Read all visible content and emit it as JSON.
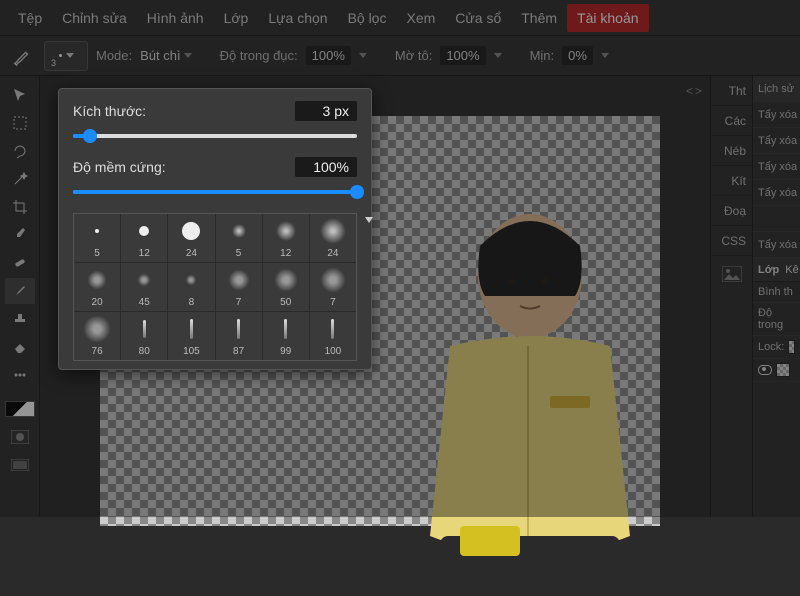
{
  "menubar": [
    "Tệp",
    "Chỉnh sửa",
    "Hình ảnh",
    "Lớp",
    "Lựa chọn",
    "Bộ lọc",
    "Xem",
    "Cửa sổ",
    "Thêm"
  ],
  "menubar_account": "Tài khoản",
  "optbar": {
    "brush_size": "3",
    "mode_label": "Mode:",
    "mode_value": "Bút chì",
    "opacity_label": "Độ trong đục:",
    "opacity_value": "100%",
    "flow_label": "Mờ tô:",
    "flow_value": "100%",
    "smooth_label": "Mịn:",
    "smooth_value": "0%"
  },
  "popup": {
    "size_label": "Kích thước:",
    "size_value": "3 px",
    "size_pct": 6,
    "hard_label": "Độ mềm cứng:",
    "hard_value": "100%",
    "hard_pct": 100,
    "presets": [
      {
        "n": "5",
        "t": "hard",
        "s": 4
      },
      {
        "n": "12",
        "t": "hard",
        "s": 10
      },
      {
        "n": "24",
        "t": "hard",
        "s": 18
      },
      {
        "n": "5",
        "t": "soft",
        "s": 8
      },
      {
        "n": "12",
        "t": "soft",
        "s": 14
      },
      {
        "n": "24",
        "t": "soft",
        "s": 20
      },
      {
        "n": "20",
        "t": "tex",
        "s": 14
      },
      {
        "n": "45",
        "t": "tex",
        "s": 8
      },
      {
        "n": "8",
        "t": "tex",
        "s": 6
      },
      {
        "n": "7",
        "t": "tex",
        "s": 16
      },
      {
        "n": "50",
        "t": "tex",
        "s": 18
      },
      {
        "n": "7",
        "t": "tex",
        "s": 20
      },
      {
        "n": "76",
        "t": "tex",
        "s": 22
      },
      {
        "n": "80",
        "t": "stroke",
        "s": 18
      },
      {
        "n": "105",
        "t": "stroke",
        "s": 20
      },
      {
        "n": "87",
        "t": "stroke",
        "s": 20
      },
      {
        "n": "99",
        "t": "stroke",
        "s": 20
      },
      {
        "n": "100",
        "t": "stroke",
        "s": 20
      }
    ]
  },
  "rpanel": {
    "items": [
      "Tht",
      "Các",
      "Néb",
      "Kít",
      "Đoạ",
      "CSS"
    ],
    "nav": "<>"
  },
  "history": {
    "tab": "Lịch sử",
    "entries": [
      "Tẩy xóa",
      "Tẩy xóa",
      "Tẩy xóa",
      "Tẩy xóa",
      "",
      "Tẩy xóa"
    ],
    "layers_tab_a": "Lớp",
    "layers_tab_b": "Kê",
    "blend": "Bình th",
    "opacity_label": "Độ trong",
    "lock_label": "Lock:"
  }
}
